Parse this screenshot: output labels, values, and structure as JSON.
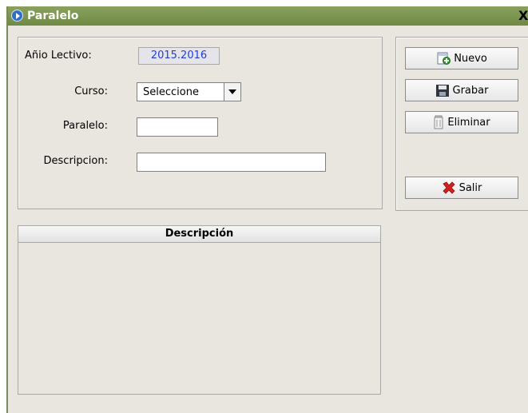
{
  "window": {
    "title": "Paralelo",
    "close_label": "X"
  },
  "form": {
    "anio_label": "Añio Lectivo:",
    "anio_value": "2015.2016",
    "curso_label": "Curso:",
    "curso_selected": "Seleccione",
    "paralelo_label": "Paralelo:",
    "paralelo_value": "",
    "descripcion_label": "Descripcion:",
    "descripcion_value": ""
  },
  "buttons": {
    "nuevo": "Nuevo",
    "grabar": "Grabar",
    "eliminar": "Eliminar",
    "salir": "Salir"
  },
  "table": {
    "columns": [
      "Descripción"
    ],
    "rows": []
  },
  "colors": {
    "titlebar": "#7a9450",
    "window_bg": "#e9e6df",
    "year_text": "#1f3fd8",
    "delete_icon": "#d42020",
    "add_icon": "#2f9e2f"
  },
  "icons": {
    "title": "app-icon",
    "nuevo": "add-document-icon",
    "grabar": "floppy-disk-icon",
    "eliminar": "trash-icon",
    "salir": "red-x-icon"
  }
}
